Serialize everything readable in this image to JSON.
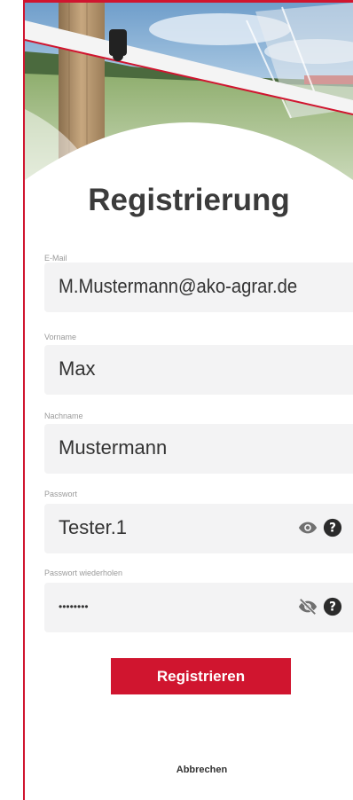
{
  "title": "Registrierung",
  "fields": {
    "email": {
      "label": "E-Mail",
      "value": "M.Mustermann@ako-agrar.de"
    },
    "firstname": {
      "label": "Vorname",
      "value": "Max"
    },
    "lastname": {
      "label": "Nachname",
      "value": "Mustermann"
    },
    "password": {
      "label": "Passwort",
      "value": "Tester.1",
      "visibility_icon": "eye-icon",
      "help_icon": "help-icon"
    },
    "password_repeat": {
      "label": "Passwort wiederholen",
      "value": "••••••••",
      "visibility_icon": "eye-off-icon",
      "help_icon": "help-icon"
    }
  },
  "buttons": {
    "register": "Registrieren",
    "cancel": "Abbrechen"
  },
  "colors": {
    "accent": "#d0152f",
    "field_bg": "#f3f3f4",
    "title": "#3b3b3b"
  }
}
